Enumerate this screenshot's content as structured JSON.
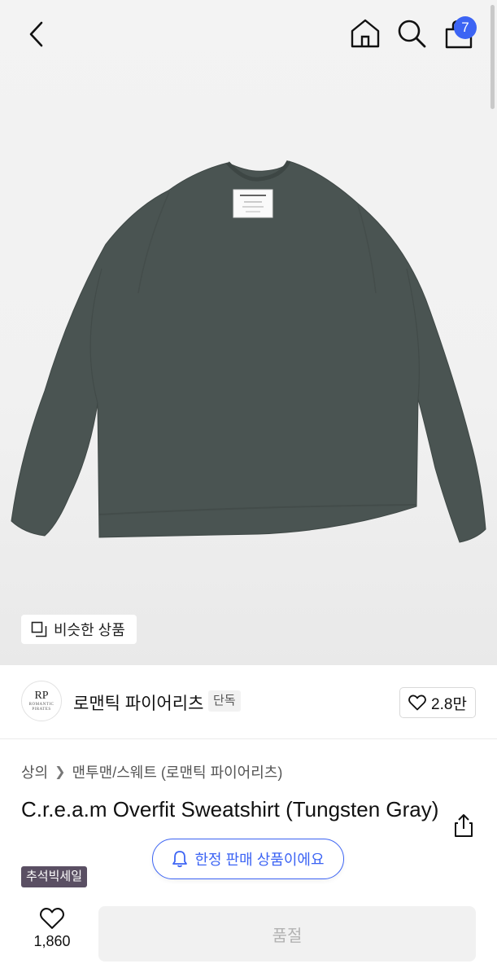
{
  "header": {
    "cart_count": "7",
    "icons": [
      "back-icon",
      "home-icon",
      "search-icon",
      "shopping-bag-icon"
    ]
  },
  "hero": {
    "similar_label": "비슷한 상품",
    "product_color": "#4a5452"
  },
  "brand": {
    "logo_text": "RP",
    "logo_subtext": "ROMANTIC PIRATES",
    "name": "로맨틱 파이어리츠",
    "tag": "단독",
    "likes": "2.8만"
  },
  "breadcrumb": {
    "category": "상의",
    "subcategory": "맨투맨/스웨트 (로맨틱 파이어리츠)"
  },
  "product": {
    "title": "C.r.e.a.m Overfit Sweatshirt (Tungsten Gray)",
    "limited_notice": "한정 판매 상품이에요",
    "sale_tag": "추석빅세일"
  },
  "bottom": {
    "like_count": "1,860",
    "buy_button": "품절"
  },
  "colors": {
    "accent": "#3c64f4",
    "sale_tag_bg": "#5a4f63"
  }
}
